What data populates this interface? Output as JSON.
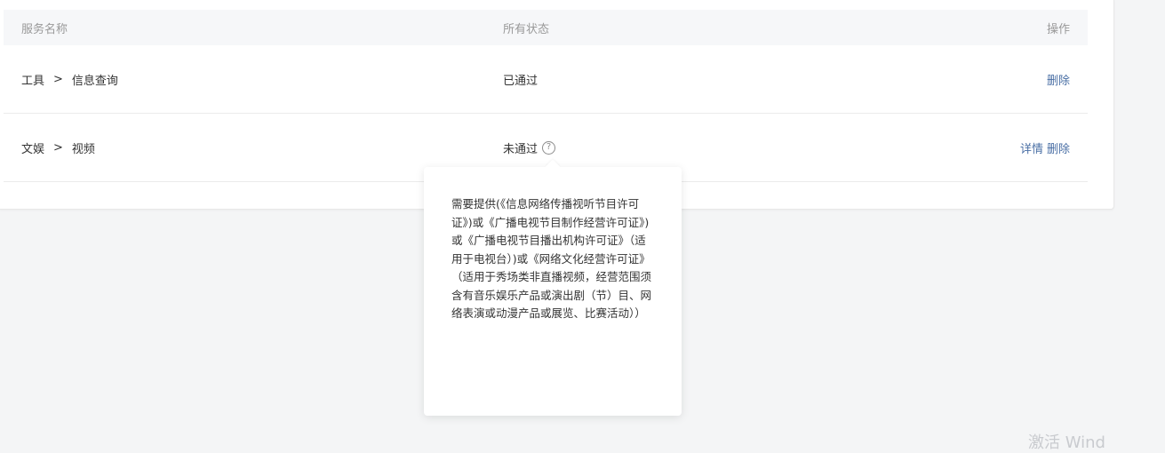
{
  "table": {
    "headers": {
      "service_name": "服务名称",
      "status": "所有状态",
      "actions": "操作"
    },
    "rows": [
      {
        "category": "工具",
        "separator": ">",
        "sub": "信息查询",
        "status": "已通过",
        "actions": [
          "删除"
        ]
      },
      {
        "category": "文娱",
        "separator": ">",
        "sub": "视频",
        "status": "未通过",
        "help_icon": "question-circle-icon",
        "actions": [
          "详情",
          "删除"
        ]
      }
    ]
  },
  "popover": {
    "text": "需要提供(《信息网络传播视听节目许可证》)或《广播电视节目制作经营许可证》)或《广播电视节目播出机构许可证》（适用于电视台）)或《网络文化经营许可证》（适用于秀场类非直播视频，经营范围须含有音乐娱乐产品或演出剧（节）目、网络表演或动漫产品或展览、比赛活动））"
  },
  "watermark": {
    "text": "激活 Wind"
  },
  "colors": {
    "link": "#4a6fa5",
    "header_bg": "#f6f7f9",
    "page_bg": "#f4f5f6"
  }
}
